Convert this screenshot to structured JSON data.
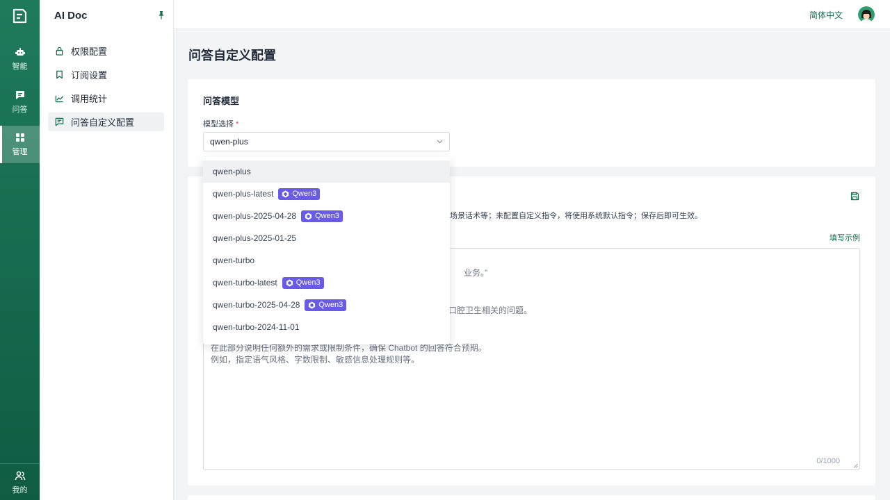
{
  "rail": {
    "items": [
      {
        "label": "智能",
        "icon": "robot-icon"
      },
      {
        "label": "问答",
        "icon": "chat-icon"
      },
      {
        "label": "管理",
        "icon": "grid-icon"
      },
      {
        "label": "我的",
        "icon": "user-icon"
      }
    ]
  },
  "sidebar": {
    "title": "AI Doc",
    "items": [
      {
        "label": "权限配置",
        "icon": "lock-icon"
      },
      {
        "label": "订阅设置",
        "icon": "bookmark-icon"
      },
      {
        "label": "调用统计",
        "icon": "chart-icon"
      },
      {
        "label": "问答自定义配置",
        "icon": "message-icon"
      }
    ]
  },
  "header": {
    "language": "简体中文"
  },
  "main": {
    "page_title": "问答自定义配置",
    "model_section": {
      "title": "问答模型",
      "field_label": "模型选择",
      "required_mark": "*",
      "selected_value": "qwen-plus"
    },
    "instruction_section": {
      "hint": "场景话术等；未配置自定义指令，将使用系统默认指令；保存后即可生效。",
      "example_link": "填写示例",
      "lines": [
        "业务。”",
        "口腔卫生相关的问题。",
        "在此部分说明任何额外的需求或限制条件，确保 Chatbot 的回答符合预期。",
        "例如，指定语气风格、字数限制、敏感信息处理规则等。"
      ],
      "counter": "0/1000"
    }
  },
  "dropdown": {
    "options": [
      {
        "label": "qwen-plus",
        "tag": ""
      },
      {
        "label": "qwen-plus-latest",
        "tag": "Qwen3"
      },
      {
        "label": "qwen-plus-2025-04-28",
        "tag": "Qwen3"
      },
      {
        "label": "qwen-plus-2025-01-25",
        "tag": ""
      },
      {
        "label": "qwen-turbo",
        "tag": ""
      },
      {
        "label": "qwen-turbo-latest",
        "tag": "Qwen3"
      },
      {
        "label": "qwen-turbo-2025-04-28",
        "tag": "Qwen3"
      },
      {
        "label": "qwen-turbo-2024-11-01",
        "tag": ""
      }
    ]
  },
  "colors": {
    "brand": "#1a6b4e",
    "tag": "#6a5ae8",
    "required": "#e5484d"
  }
}
